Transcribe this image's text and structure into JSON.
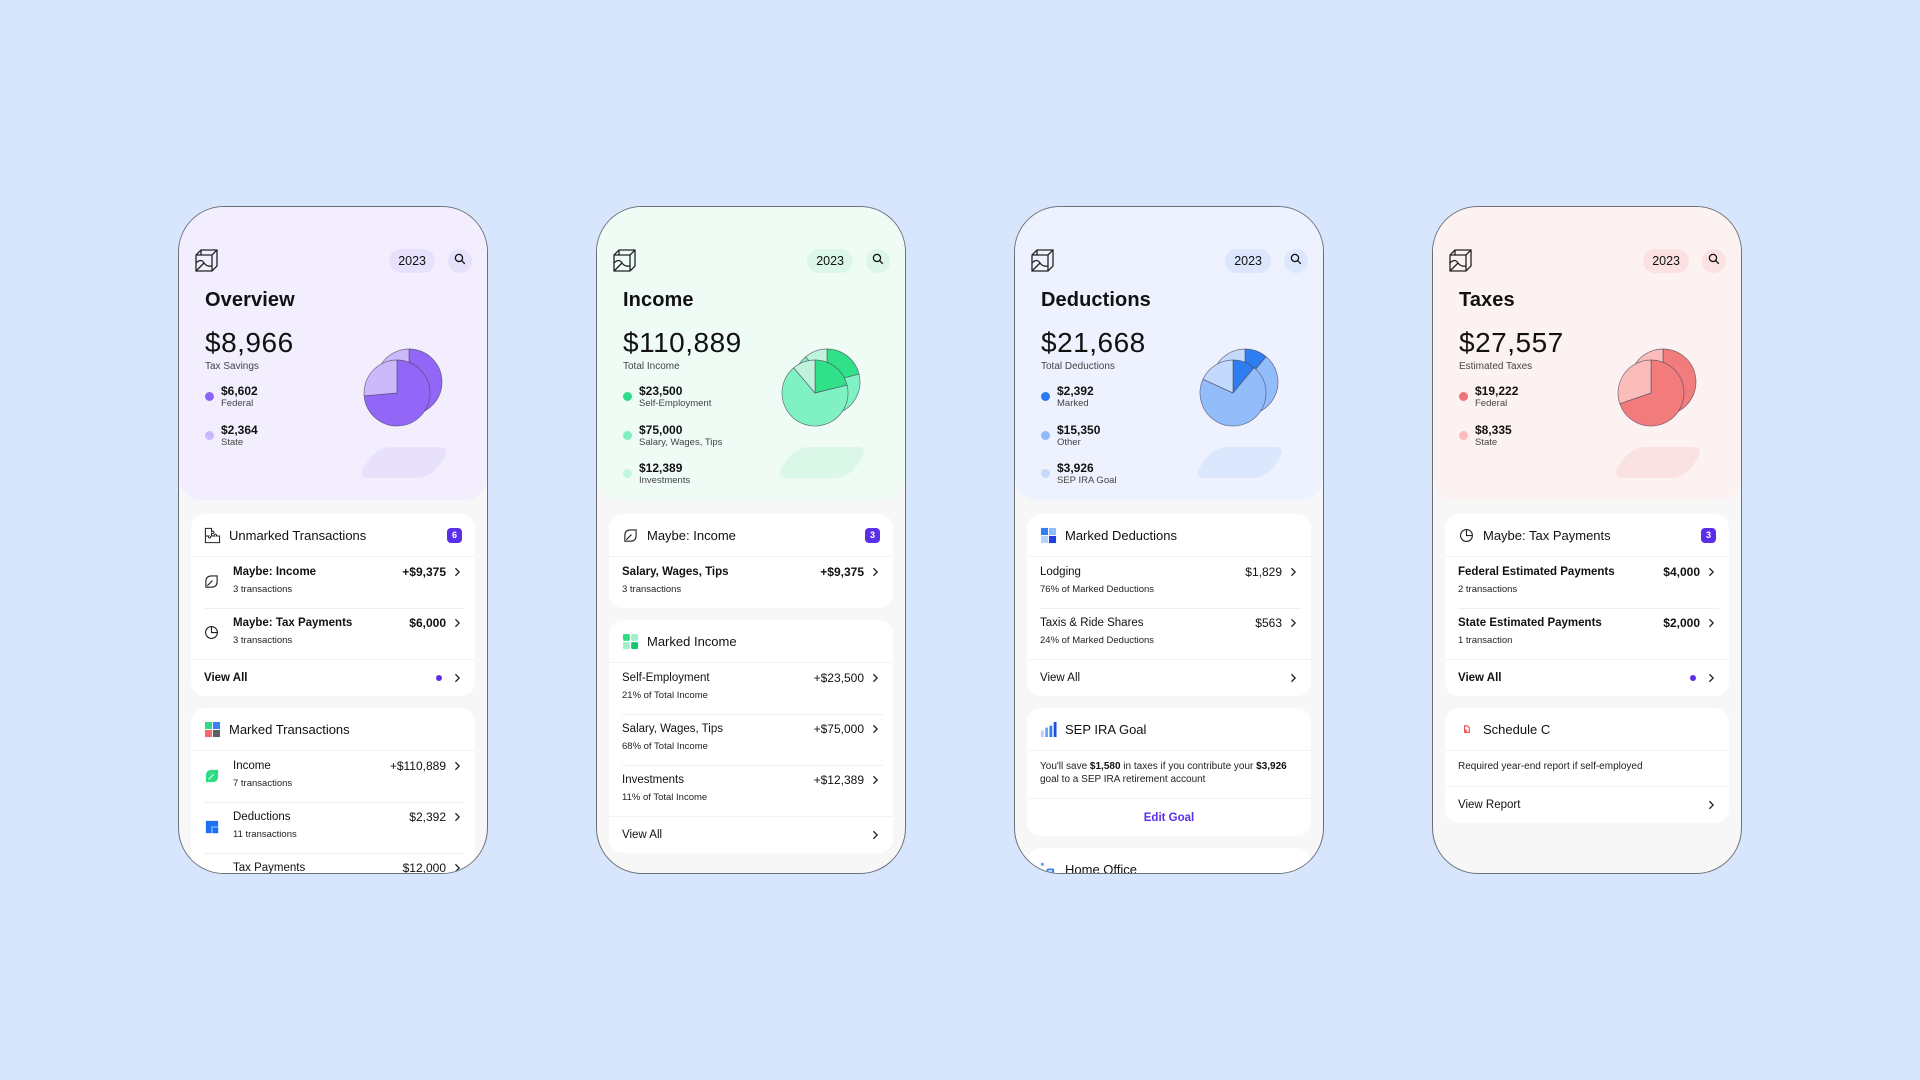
{
  "colors": {
    "background": "#d8e6fd",
    "accent": "#5b2ee8"
  },
  "phones": [
    {
      "logo": "cube-logo-icon",
      "year": "2023",
      "search_icon": "search-icon",
      "title": "Overview",
      "amount": "$8,966",
      "amount_label": "Tax Savings",
      "theme": {
        "hero_bg": "#f2eefe"
      },
      "legend": [
        {
          "value": "$6,602",
          "label": "Federal",
          "color": "#8b63f5"
        },
        {
          "value": "$2,364",
          "label": "State",
          "color": "#c9b8fb"
        }
      ],
      "pie": {
        "slices": [
          {
            "label": "Federal",
            "value": 6602,
            "color": "#9266f6"
          },
          {
            "label": "State",
            "value": 2364,
            "color": "#cbb9fb"
          }
        ]
      },
      "cards": [
        {
          "type": "list",
          "icon": "puzzle-icon",
          "title": "Unmarked Transactions",
          "badge": "6",
          "rows": [
            {
              "icon": "leaf-outline-icon",
              "title": "Maybe: Income",
              "sub": "3 transactions",
              "amount": "+$9,375"
            },
            {
              "icon": "pie-clock-icon",
              "title": "Maybe: Tax Payments",
              "sub": "3 transactions",
              "amount": "$6,000"
            }
          ],
          "footer": {
            "label": "View All",
            "dot": true
          }
        },
        {
          "type": "list",
          "icon": "colored-puzzle-icon",
          "title": "Marked Transactions",
          "rows": [
            {
              "icon": "leaf-green-icon",
              "title": "Income",
              "sub": "7 transactions",
              "amount": "+$110,889"
            },
            {
              "icon": "blue-square-icon",
              "title": "Deductions",
              "sub": "11 transactions",
              "amount": "$2,392"
            },
            {
              "icon": "",
              "title": "Tax Payments",
              "sub": "",
              "amount": "$12,000"
            }
          ]
        }
      ]
    },
    {
      "logo": "cube-logo-icon",
      "year": "2023",
      "search_icon": "search-icon",
      "title": "Income",
      "amount": "$110,889",
      "amount_label": "Total Income",
      "theme": {
        "hero_bg": "#effcf5"
      },
      "legend": [
        {
          "value": "$23,500",
          "label": "Self-Employment",
          "color": "#2ede86"
        },
        {
          "value": "$75,000",
          "label": "Salary, Wages, Tips",
          "color": "#7ef0bf"
        },
        {
          "value": "$12,389",
          "label": "Investments",
          "color": "#c2f5de"
        }
      ],
      "pie": {
        "slices": [
          {
            "label": "Self-Employment",
            "value": 23500,
            "color": "#30e189"
          },
          {
            "label": "Salary, Wages, Tips",
            "value": 75000,
            "color": "#7ff1c2"
          },
          {
            "label": "Investments",
            "value": 12389,
            "color": "#bff3dc"
          }
        ]
      },
      "cards": [
        {
          "type": "list",
          "icon": "leaf-outline-icon",
          "title": "Maybe: Income",
          "badge": "3",
          "rows": [
            {
              "title": "Salary, Wages, Tips",
              "sub": "3 transactions",
              "amount": "+$9,375"
            }
          ]
        },
        {
          "type": "list-regular",
          "icon": "green-grid-icon",
          "title": "Marked Income",
          "rows": [
            {
              "title": "Self-Employment",
              "sub": "21% of Total Income",
              "amount": "+$23,500"
            },
            {
              "title": "Salary, Wages, Tips",
              "sub": "68% of Total Income",
              "amount": "+$75,000"
            },
            {
              "title": "Investments",
              "sub": "11% of Total Income",
              "amount": "+$12,389"
            }
          ],
          "footer": {
            "label": "View All",
            "dot": false
          }
        }
      ]
    },
    {
      "logo": "cube-logo-icon",
      "year": "2023",
      "search_icon": "search-icon",
      "title": "Deductions",
      "amount": "$21,668",
      "amount_label": "Total Deductions",
      "theme": {
        "hero_bg": "#eef2fe"
      },
      "legend": [
        {
          "value": "$2,392",
          "label": "Marked",
          "color": "#2b7bf0"
        },
        {
          "value": "$15,350",
          "label": "Other",
          "color": "#8fb9fb"
        },
        {
          "value": "$3,926",
          "label": "SEP IRA Goal",
          "color": "#c4dafd"
        }
      ],
      "pie": {
        "slices": [
          {
            "label": "Marked",
            "value": 2392,
            "color": "#2e7ef2"
          },
          {
            "label": "Other",
            "value": 15350,
            "color": "#93bcfb"
          },
          {
            "label": "SEP IRA Goal",
            "value": 3926,
            "color": "#c3d9fd"
          }
        ]
      },
      "cards": [
        {
          "type": "list-regular",
          "icon": "blue-grid-icon",
          "title": "Marked Deductions",
          "rows": [
            {
              "title": "Lodging",
              "sub": "76% of Marked Deductions",
              "amount": "$1,829"
            },
            {
              "title": "Taxis & Ride Shares",
              "sub": "24% of Marked Deductions",
              "amount": "$563"
            }
          ],
          "footer": {
            "label": "View All",
            "dot": false
          }
        },
        {
          "type": "goal",
          "icon": "bar-chart-icon",
          "title": "SEP IRA Goal",
          "text_parts": [
            "You'll save ",
            "$1,580",
            " in taxes if you contribute your ",
            "$3,926",
            " goal to a SEP IRA retirement account"
          ],
          "link": "Edit Goal"
        },
        {
          "type": "header-only",
          "icon": "home-office-icon",
          "title": "Home Office"
        }
      ]
    },
    {
      "logo": "cube-logo-icon",
      "year": "2023",
      "search_icon": "search-icon",
      "title": "Taxes",
      "amount": "$27,557",
      "amount_label": "Estimated Taxes",
      "theme": {
        "hero_bg": "#fdf2f2"
      },
      "legend": [
        {
          "value": "$19,222",
          "label": "Federal",
          "color": "#ef7378"
        },
        {
          "value": "$8,335",
          "label": "State",
          "color": "#fbbcbb"
        }
      ],
      "pie": {
        "slices": [
          {
            "label": "Federal",
            "value": 19222,
            "color": "#f27b7c"
          },
          {
            "label": "State",
            "value": 8335,
            "color": "#fbbdba"
          }
        ]
      },
      "cards": [
        {
          "type": "list",
          "icon": "pie-clock-icon",
          "title": "Maybe: Tax Payments",
          "badge": "3",
          "rows": [
            {
              "title": "Federal Estimated Payments",
              "sub": "2 transactions",
              "amount": "$4,000"
            },
            {
              "title": "State Estimated Payments",
              "sub": "1 transaction",
              "amount": "$2,000"
            }
          ],
          "footer": {
            "label": "View All",
            "dot": true
          }
        },
        {
          "type": "report",
          "icon": "document-icon",
          "title": "Schedule C",
          "text": "Required year-end report if self-employed",
          "footer": {
            "label": "View Report",
            "dot": false
          }
        }
      ]
    }
  ]
}
